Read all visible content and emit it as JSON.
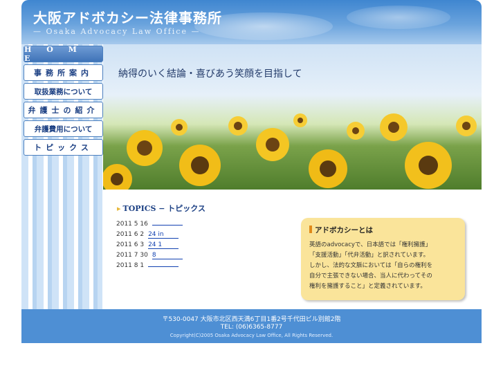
{
  "site": {
    "title": "大阪アドボカシー法律事務所",
    "subtitle": "— Osaka Advocacy Law Office —"
  },
  "nav": {
    "items": [
      {
        "label": "H O M E"
      },
      {
        "label": "事務所案内"
      },
      {
        "label": "取扱業務について"
      },
      {
        "label": "弁護士の紹介"
      },
      {
        "label": "弁護費用について"
      },
      {
        "label": "トピックス"
      }
    ]
  },
  "hero": {
    "slogan": "納得のいく結論・喜びあう笑顔を目指して"
  },
  "topics": {
    "title": "TOPICS − トピックス",
    "items": [
      {
        "date": "2011  5 16",
        "link": ""
      },
      {
        "date": "2011  6  2",
        "link": "24     in"
      },
      {
        "date": "2011  6  3",
        "link": "24         1"
      },
      {
        "date": "2011  7 30",
        "link": "8"
      },
      {
        "date": "2011  8  1",
        "link": ""
      }
    ]
  },
  "about": {
    "title": "アドボカシーとは",
    "lines": [
      "英語のadvocacyで、日本語では「権利擁護」",
      "「支援活動」「代弁活動」と訳されています。",
      "しかし、法的な文脈においては「自らの権利を",
      "自分で主張できない場合、当人に代わってその",
      "権利を擁護すること」と定義されています。"
    ]
  },
  "footer": {
    "address": "〒530-0047 大阪市北区西天満6丁目1番2号千代田ビル別館2階",
    "tel": "TEL: (06)6365-8777",
    "copyright": "Copyright(C)2005 Osaka Advocacy Law Office, All Rights Reserved."
  },
  "colors": {
    "header_blue": "#4e8fd4",
    "nav_text": "#1b3f83",
    "link": "#1040b0",
    "about_bg": "#fae49a",
    "accent_orange": "#e08a1a"
  }
}
